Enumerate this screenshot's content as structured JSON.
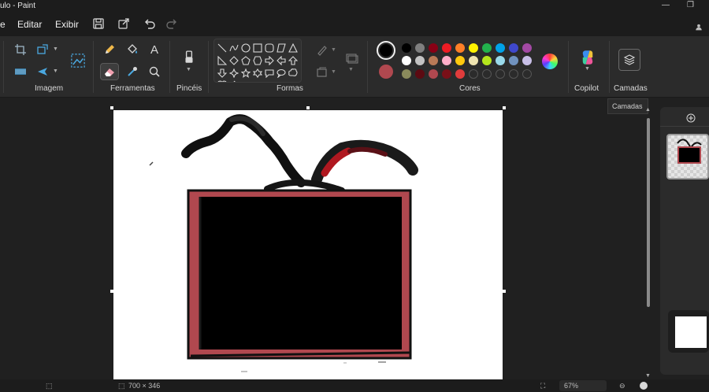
{
  "app": {
    "title": "ulo - Paint"
  },
  "menu": {
    "items": [
      "Editar",
      "Exibir"
    ]
  },
  "ribbon": {
    "groups": {
      "imagem": "Imagem",
      "ferramentas": "Ferramentas",
      "pinceis": "Pincéis",
      "formas": "Formas",
      "cores": "Cores",
      "copilot": "Copilot",
      "camadas": "Camadas"
    },
    "tools": {
      "text_glyph": "A"
    }
  },
  "colors": {
    "primary": "#000000",
    "secondary": "#b0484f",
    "palette_row1": [
      "#000000",
      "#7f7f7f",
      "#880015",
      "#ed1c24",
      "#ff7f27",
      "#fff200",
      "#22b14c",
      "#00a2e8",
      "#3f48cc",
      "#a349a4"
    ],
    "palette_row2": [
      "#ffffff",
      "#c3c3c3",
      "#b97a57",
      "#ffaec9",
      "#ffc90e",
      "#efe4b0",
      "#b5e61d",
      "#99d9ea",
      "#7092be",
      "#c8bfe7"
    ],
    "palette_row3": [
      "#8a8a5c",
      "#5c0a12",
      "#b0484f",
      "#7a1018",
      "#e03c3c"
    ]
  },
  "tooltip": {
    "text": "Camadas"
  },
  "status": {
    "canvas_size": "700 × 346",
    "zoom": "67%"
  }
}
